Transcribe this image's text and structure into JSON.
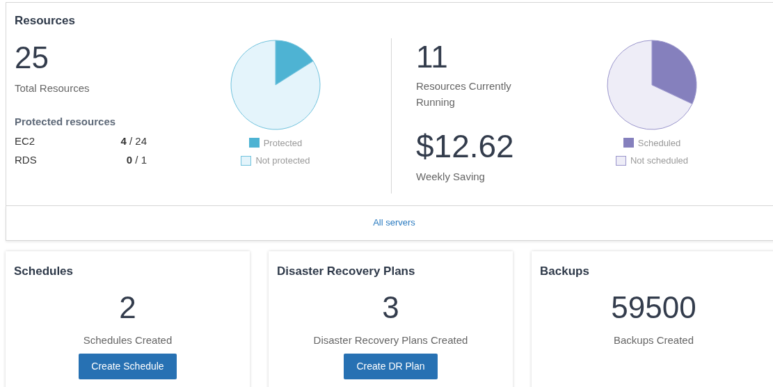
{
  "resources": {
    "title": "Resources",
    "total": {
      "value": "25",
      "label": "Total Resources"
    },
    "protected": {
      "heading": "Protected resources",
      "rows": [
        {
          "name": "EC2",
          "count": "**4** / 24"
        },
        {
          "name": "RDS",
          "count": "**0** / 1"
        }
      ]
    },
    "protection_chart": {
      "chart_data": {
        "type": "pie",
        "categories": [
          "Protected",
          "Not protected"
        ],
        "values": [
          16,
          84
        ],
        "legend": "bottom"
      }
    },
    "running": {
      "value": "11",
      "label": "Resources Currently Running"
    },
    "saving": {
      "value": "$12.62",
      "label": "Weekly Saving"
    },
    "schedule_chart": {
      "chart_data": {
        "type": "pie",
        "categories": [
          "Scheduled",
          "Not scheduled"
        ],
        "values": [
          32,
          68
        ],
        "legend": "bottom"
      }
    },
    "link": "All servers"
  },
  "cards": [
    {
      "title": "Schedules",
      "value": "2",
      "label": "Schedules Created",
      "button": "Create Schedule"
    },
    {
      "title": "Disaster Recovery Plans",
      "value": "3",
      "label": "Disaster Recovery Plans Created",
      "button": "Create DR Plan"
    },
    {
      "title": "Backups",
      "value": "59500",
      "label": "Backups Created"
    }
  ]
}
